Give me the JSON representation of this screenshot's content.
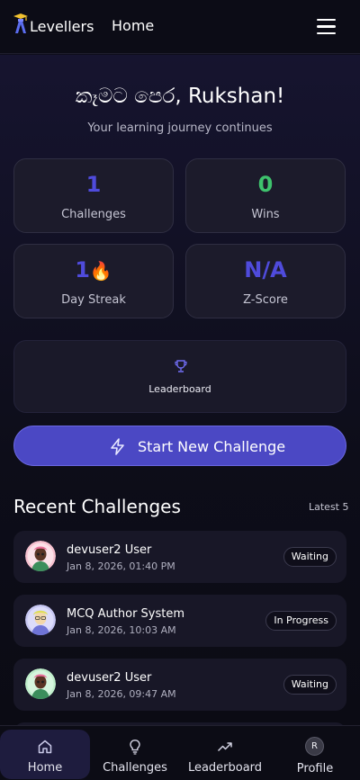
{
  "header": {
    "brand": "Levellers",
    "nav_home": "Home"
  },
  "hero": {
    "greeting": "කෑමට පෙර, Rukshan!",
    "subtitle": "Your learning journey continues"
  },
  "stats": [
    {
      "value": "1",
      "label": "Challenges",
      "color": "#4f4bdc"
    },
    {
      "value": "0",
      "label": "Wins",
      "color": "#3ec26d"
    },
    {
      "value": "1",
      "emoji": "🔥",
      "label": "Day Streak",
      "color": "#4f4bdc"
    },
    {
      "value": "N/A",
      "label": "Z-Score",
      "color": "#4f4bdc"
    }
  ],
  "leaderboard_card": {
    "label": "Leaderboard",
    "icon": "trophy-icon"
  },
  "start_button": {
    "label": "Start New Challenge",
    "icon": "bolt-icon"
  },
  "recent": {
    "title": "Recent Challenges",
    "meta": "Latest 5",
    "items": [
      {
        "title": "devuser2 User",
        "date": "Jan 8, 2026, 01:40 PM",
        "status": "Waiting"
      },
      {
        "title": "MCQ Author System",
        "date": "Jan 8, 2026, 10:03 AM",
        "status": "In Progress"
      },
      {
        "title": "devuser2 User",
        "date": "Jan 8, 2026, 09:47 AM",
        "status": "Waiting"
      }
    ]
  },
  "bottom_nav": {
    "items": [
      {
        "label": "Home",
        "icon": "home-icon",
        "active": true
      },
      {
        "label": "Challenges",
        "icon": "lightbulb-icon"
      },
      {
        "label": "Leaderboard",
        "icon": "trending-up-icon"
      },
      {
        "label": "Profile",
        "icon": "avatar",
        "initial": "R"
      }
    ]
  },
  "colors": {
    "accent": "#4b48c4",
    "success": "#3ec26d",
    "background": "#0e0d1c"
  }
}
